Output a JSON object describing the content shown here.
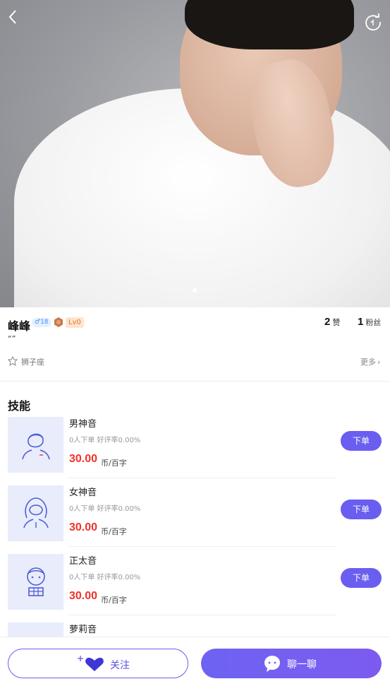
{
  "profile": {
    "name": "峰峰",
    "gender_age": "♂18",
    "level": "Lv0",
    "likes_count": "2",
    "likes_label": "赞",
    "fans_count": "1",
    "fans_label": "粉丝",
    "signature": "“”",
    "zodiac": "狮子座",
    "more_label": "更多"
  },
  "skills": {
    "title": "技能",
    "items": [
      {
        "name": "男神音",
        "meta": "0人下单 好评率0.00%",
        "price": "30.00",
        "unit": "币/百字",
        "order_label": "下单",
        "icon": "male-avatar-icon"
      },
      {
        "name": "女神音",
        "meta": "0人下单 好评率0.00%",
        "price": "30.00",
        "unit": "币/百字",
        "order_label": "下单",
        "icon": "female-avatar-icon"
      },
      {
        "name": "正太音",
        "meta": "0人下单 好评率0.00%",
        "price": "30.00",
        "unit": "币/百字",
        "order_label": "下单",
        "icon": "boy-avatar-icon"
      },
      {
        "name": "萝莉音",
        "meta": "",
        "price": "",
        "unit": "",
        "order_label": "",
        "icon": "girl-avatar-icon"
      }
    ]
  },
  "bottom_bar": {
    "follow_label": "关注",
    "chat_label": "聊一聊"
  },
  "colors": {
    "accent": "#6a5ef0",
    "price": "#f0322a"
  }
}
